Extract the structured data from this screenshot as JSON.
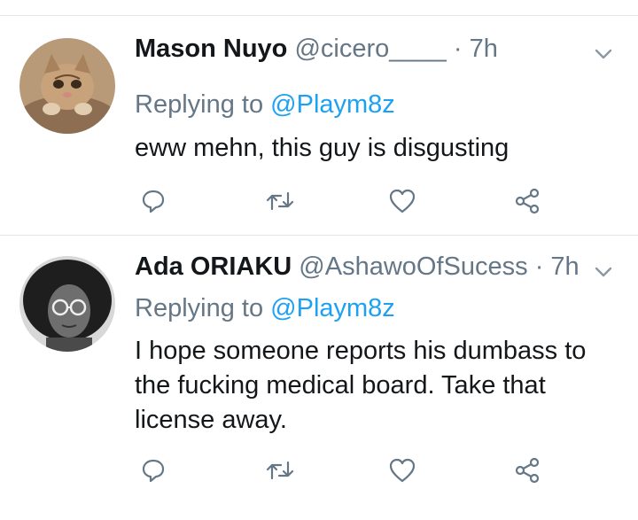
{
  "tweets": [
    {
      "name": "Mason Nuyo",
      "handle": "@cicero____",
      "separator": "·",
      "time": "7h",
      "reply_prefix": "Replying to",
      "reply_to": "@Playm8z",
      "text": "eww mehn, this guy is disgusting"
    },
    {
      "name": "Ada ORIAKU",
      "handle": "@AshawoOfSucess",
      "separator": "·",
      "time": "7h",
      "reply_prefix": "Replying to",
      "reply_to": "@Playm8z",
      "text": "I hope someone reports his dumbass to the fucking medical board. Take that license away."
    }
  ],
  "icons": {
    "reply": "reply-icon",
    "retweet": "retweet-icon",
    "like": "heart-icon",
    "share": "share-icon",
    "menu": "chevron-down-icon"
  },
  "colors": {
    "text": "#14171a",
    "muted": "#657786",
    "link": "#1da1f2",
    "divider": "#e1e8ed"
  }
}
